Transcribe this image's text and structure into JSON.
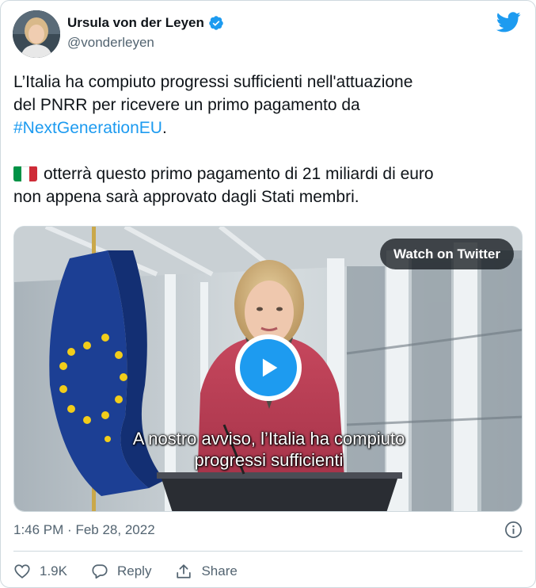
{
  "author": {
    "name": "Ursula von der Leyen",
    "handle": "@vonderleyen"
  },
  "tweet": {
    "line1": "L’Italia ha compiuto progressi sufficienti nell'attuazione",
    "line2": "del PNRR per ricevere un primo pagamento da",
    "hashtag": "#NextGenerationEU",
    "hashtag_suffix": ".",
    "line4": "otterrà questo primo pagamento di 21 miliardi di euro",
    "line5": "non appena sarà approvato dagli Stati membri."
  },
  "media": {
    "watch_label": "Watch on Twitter",
    "caption_line1": "A nostro avviso, l’Italia ha compiuto",
    "caption_line2": "progressi sufficienti"
  },
  "meta": {
    "time": "1:46 PM",
    "separator": "·",
    "date": "Feb 28, 2022"
  },
  "actions": {
    "like_count": "1.9K",
    "reply_label": "Reply",
    "share_label": "Share"
  },
  "colors": {
    "accent": "#1d9bf0",
    "muted": "#536471",
    "text": "#0f1419",
    "flag_green": "#009246",
    "flag_white": "#ffffff",
    "flag_red": "#ce2b37"
  },
  "icons": [
    "verified-badge-icon",
    "twitter-bird-icon",
    "italy-flag-icon",
    "play-icon",
    "info-icon",
    "heart-icon",
    "reply-icon",
    "share-icon"
  ]
}
